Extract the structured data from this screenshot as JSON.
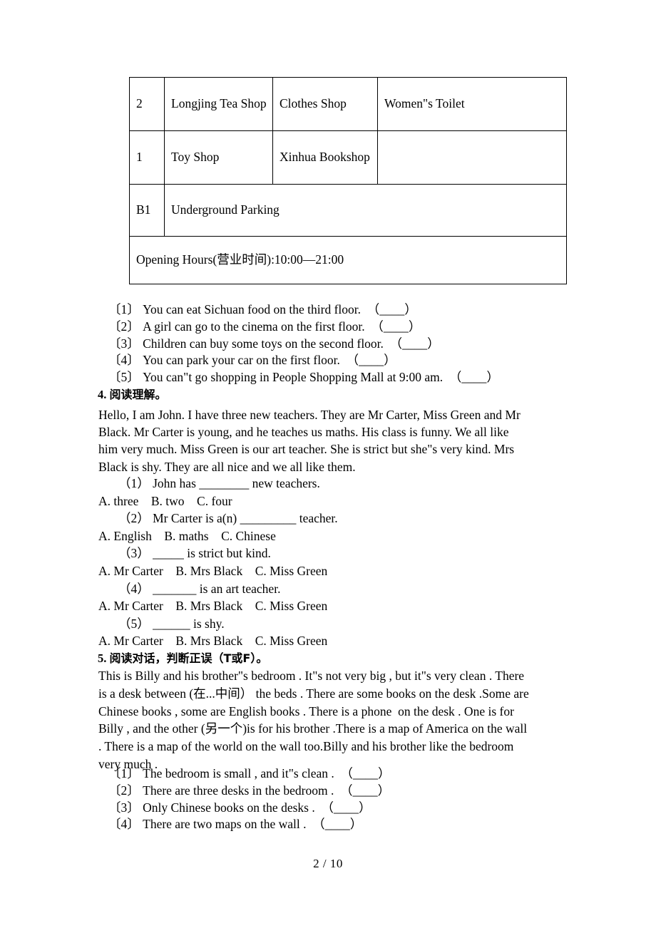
{
  "document": {
    "page_footer": "2 / 10"
  },
  "mall_table": {
    "rows": [
      {
        "floor": "2",
        "col_a": "Longjing Tea Shop",
        "col_b": "Clothes Shop",
        "col_c": "Women\"s Toilet"
      },
      {
        "floor": "1",
        "col_a": "Toy Shop",
        "col_b": "Xinhua Bookshop",
        "col_c": ""
      },
      {
        "floor": "B1",
        "col_a": "Underground Parking",
        "col_b": "",
        "col_c": ""
      }
    ],
    "opening_hours": "Opening Hours(营业时间):10:00—21:00"
  },
  "section3_statements": [
    {
      "num": "〔1〕",
      "text": "You can eat Sichuan food on the third floor.",
      "answer_blank": "（____）"
    },
    {
      "num": "〔2〕",
      "text": "A girl can go to the cinema on the first floor.",
      "answer_blank": "（____）"
    },
    {
      "num": "〔3〕",
      "text": "Children can buy some toys on the second floor.",
      "answer_blank": "（____）"
    },
    {
      "num": "〔4〕",
      "text": "You can park your car on the first floor.",
      "answer_blank": "（____）"
    },
    {
      "num": "〔5〕",
      "text": "You can\"t go shopping in People Shopping Mall at 9:00 am.",
      "answer_blank": "（____）"
    }
  ],
  "section4": {
    "heading_num": "4.",
    "heading_text": "阅读理解",
    "heading_punct": "。",
    "passage_lines": [
      "Hello, I am John. I have three new teachers. They are Mr Carter, Miss Green and Mr",
      "Black. Mr Carter is young, and he teaches us maths. His class is funny. We all like",
      "him very much. Miss Green is our art teacher. She is strict but she\"s very kind. Mrs",
      "Black is shy. They are all nice and we all like them."
    ],
    "questions": [
      {
        "num": "（1）",
        "stem": "John has ________ new teachers.",
        "options": "A. three    B. two    C. four"
      },
      {
        "num": "（2）",
        "stem": "Mr Carter is a(n) _________ teacher.",
        "options": "A. English    B. maths    C. Chinese"
      },
      {
        "num": "（3）",
        "stem": "_____ is strict but kind.",
        "options": "A. Mr Carter    B. Mrs Black    C. Miss Green"
      },
      {
        "num": "（4）",
        "stem": "_______ is an art teacher.",
        "options": "A. Mr Carter    B. Mrs Black    C. Miss Green"
      },
      {
        "num": "（5）",
        "stem": "______ is shy.",
        "options": "A. Mr Carter    B. Mrs Black    C. Miss Green"
      }
    ]
  },
  "section5": {
    "heading_num": "5.",
    "heading_text": "阅读对话，判断正误（T或F）",
    "heading_punct": "。",
    "passage_lines": [
      "This is Billy and his brother\"s bedroom . It\"s not very big , but it\"s very clean . There",
      "is a desk between (在...中间） the beds . There are some books on the desk .Some are",
      "Chinese books , some are English books . There is a phone  on the desk . One is for",
      "Billy , and the other (另一个)is for his brother .There is a map of America on the wall",
      ". There is a map of the world on the wall too.Billy and his brother like the bedroom",
      "very much ."
    ],
    "statements": [
      {
        "num": "〔1〕",
        "text": "The bedroom is small , and it\"s clean .",
        "answer_blank": "（____）"
      },
      {
        "num": "〔2〕",
        "text": "There are three desks in the bedroom .",
        "answer_blank": "（____）"
      },
      {
        "num": "〔3〕",
        "text": "Only Chinese books on the desks .",
        "answer_blank": "（____）"
      },
      {
        "num": "〔4〕",
        "text": "There are two maps on the wall .",
        "answer_blank": "（____）"
      }
    ]
  }
}
